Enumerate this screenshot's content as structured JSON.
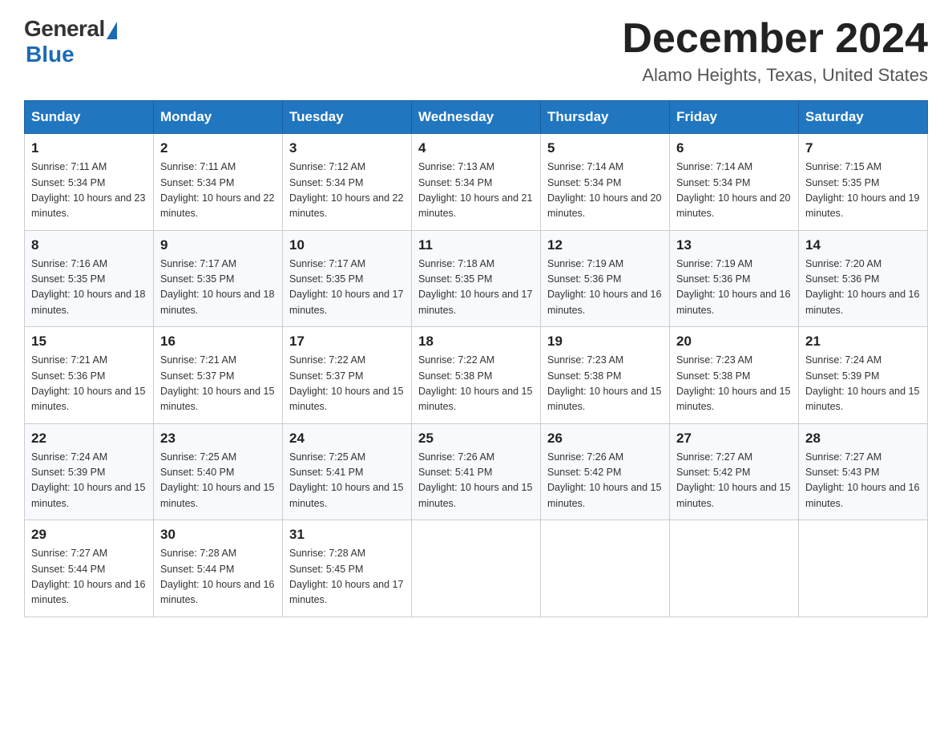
{
  "logo": {
    "general": "General",
    "blue": "Blue"
  },
  "header": {
    "month": "December 2024",
    "location": "Alamo Heights, Texas, United States"
  },
  "days_of_week": [
    "Sunday",
    "Monday",
    "Tuesday",
    "Wednesday",
    "Thursday",
    "Friday",
    "Saturday"
  ],
  "weeks": [
    [
      {
        "day": "1",
        "sunrise": "7:11 AM",
        "sunset": "5:34 PM",
        "daylight": "10 hours and 23 minutes."
      },
      {
        "day": "2",
        "sunrise": "7:11 AM",
        "sunset": "5:34 PM",
        "daylight": "10 hours and 22 minutes."
      },
      {
        "day": "3",
        "sunrise": "7:12 AM",
        "sunset": "5:34 PM",
        "daylight": "10 hours and 22 minutes."
      },
      {
        "day": "4",
        "sunrise": "7:13 AM",
        "sunset": "5:34 PM",
        "daylight": "10 hours and 21 minutes."
      },
      {
        "day": "5",
        "sunrise": "7:14 AM",
        "sunset": "5:34 PM",
        "daylight": "10 hours and 20 minutes."
      },
      {
        "day": "6",
        "sunrise": "7:14 AM",
        "sunset": "5:34 PM",
        "daylight": "10 hours and 20 minutes."
      },
      {
        "day": "7",
        "sunrise": "7:15 AM",
        "sunset": "5:35 PM",
        "daylight": "10 hours and 19 minutes."
      }
    ],
    [
      {
        "day": "8",
        "sunrise": "7:16 AM",
        "sunset": "5:35 PM",
        "daylight": "10 hours and 18 minutes."
      },
      {
        "day": "9",
        "sunrise": "7:17 AM",
        "sunset": "5:35 PM",
        "daylight": "10 hours and 18 minutes."
      },
      {
        "day": "10",
        "sunrise": "7:17 AM",
        "sunset": "5:35 PM",
        "daylight": "10 hours and 17 minutes."
      },
      {
        "day": "11",
        "sunrise": "7:18 AM",
        "sunset": "5:35 PM",
        "daylight": "10 hours and 17 minutes."
      },
      {
        "day": "12",
        "sunrise": "7:19 AM",
        "sunset": "5:36 PM",
        "daylight": "10 hours and 16 minutes."
      },
      {
        "day": "13",
        "sunrise": "7:19 AM",
        "sunset": "5:36 PM",
        "daylight": "10 hours and 16 minutes."
      },
      {
        "day": "14",
        "sunrise": "7:20 AM",
        "sunset": "5:36 PM",
        "daylight": "10 hours and 16 minutes."
      }
    ],
    [
      {
        "day": "15",
        "sunrise": "7:21 AM",
        "sunset": "5:36 PM",
        "daylight": "10 hours and 15 minutes."
      },
      {
        "day": "16",
        "sunrise": "7:21 AM",
        "sunset": "5:37 PM",
        "daylight": "10 hours and 15 minutes."
      },
      {
        "day": "17",
        "sunrise": "7:22 AM",
        "sunset": "5:37 PM",
        "daylight": "10 hours and 15 minutes."
      },
      {
        "day": "18",
        "sunrise": "7:22 AM",
        "sunset": "5:38 PM",
        "daylight": "10 hours and 15 minutes."
      },
      {
        "day": "19",
        "sunrise": "7:23 AM",
        "sunset": "5:38 PM",
        "daylight": "10 hours and 15 minutes."
      },
      {
        "day": "20",
        "sunrise": "7:23 AM",
        "sunset": "5:38 PM",
        "daylight": "10 hours and 15 minutes."
      },
      {
        "day": "21",
        "sunrise": "7:24 AM",
        "sunset": "5:39 PM",
        "daylight": "10 hours and 15 minutes."
      }
    ],
    [
      {
        "day": "22",
        "sunrise": "7:24 AM",
        "sunset": "5:39 PM",
        "daylight": "10 hours and 15 minutes."
      },
      {
        "day": "23",
        "sunrise": "7:25 AM",
        "sunset": "5:40 PM",
        "daylight": "10 hours and 15 minutes."
      },
      {
        "day": "24",
        "sunrise": "7:25 AM",
        "sunset": "5:41 PM",
        "daylight": "10 hours and 15 minutes."
      },
      {
        "day": "25",
        "sunrise": "7:26 AM",
        "sunset": "5:41 PM",
        "daylight": "10 hours and 15 minutes."
      },
      {
        "day": "26",
        "sunrise": "7:26 AM",
        "sunset": "5:42 PM",
        "daylight": "10 hours and 15 minutes."
      },
      {
        "day": "27",
        "sunrise": "7:27 AM",
        "sunset": "5:42 PM",
        "daylight": "10 hours and 15 minutes."
      },
      {
        "day": "28",
        "sunrise": "7:27 AM",
        "sunset": "5:43 PM",
        "daylight": "10 hours and 16 minutes."
      }
    ],
    [
      {
        "day": "29",
        "sunrise": "7:27 AM",
        "sunset": "5:44 PM",
        "daylight": "10 hours and 16 minutes."
      },
      {
        "day": "30",
        "sunrise": "7:28 AM",
        "sunset": "5:44 PM",
        "daylight": "10 hours and 16 minutes."
      },
      {
        "day": "31",
        "sunrise": "7:28 AM",
        "sunset": "5:45 PM",
        "daylight": "10 hours and 17 minutes."
      },
      null,
      null,
      null,
      null
    ]
  ]
}
